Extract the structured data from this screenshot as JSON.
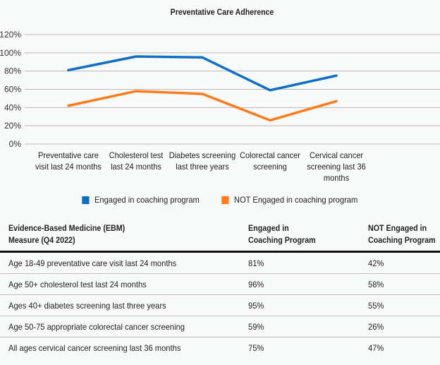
{
  "chart_data": {
    "type": "line",
    "title": "Preventative Care Adherence",
    "xlabel": "",
    "ylabel": "",
    "ylim": [
      0,
      120
    ],
    "yticks": [
      "0%",
      "20%",
      "40%",
      "60%",
      "80%",
      "100%",
      "120%"
    ],
    "ytick_values": [
      0,
      20,
      40,
      60,
      80,
      100,
      120
    ],
    "grid": true,
    "legend_position": "bottom",
    "categories": [
      [
        "Preventative care",
        "visit last 24 months"
      ],
      [
        "Cholesterol test",
        "last 24 months"
      ],
      [
        "Diabetes screening",
        "last three years"
      ],
      [
        "Colorectal cancer",
        "screening"
      ],
      [
        "Cervical cancer",
        "screening last 36",
        "months"
      ]
    ],
    "series": [
      {
        "name": "Engaged in coaching program",
        "color": "#0f6fc6",
        "values": [
          81,
          96,
          95,
          59,
          75
        ]
      },
      {
        "name": "NOT Engaged in coaching program",
        "color": "#ff7a1a",
        "values": [
          42,
          58,
          55,
          26,
          47
        ]
      }
    ]
  },
  "table": {
    "headers": [
      [
        "Evidence-Based Medicine (EBM)",
        "Measure (Q4 2022)"
      ],
      [
        "Engaged in",
        "Coaching Program"
      ],
      [
        "NOT Engaged in",
        "Coaching Program"
      ]
    ],
    "rows": [
      [
        "Age 18-49 preventative care visit last 24 months",
        "81%",
        "42%"
      ],
      [
        "Age 50+ cholesterol test last 24 months",
        "96%",
        "58%"
      ],
      [
        "Ages 40+ diabetes screening last three years",
        "95%",
        "55%"
      ],
      [
        "Age 50-75 appropriate colorectal cancer screening",
        "59%",
        "26%"
      ],
      [
        "All ages cervical cancer screening last 36 months",
        "75%",
        "47%"
      ]
    ]
  }
}
